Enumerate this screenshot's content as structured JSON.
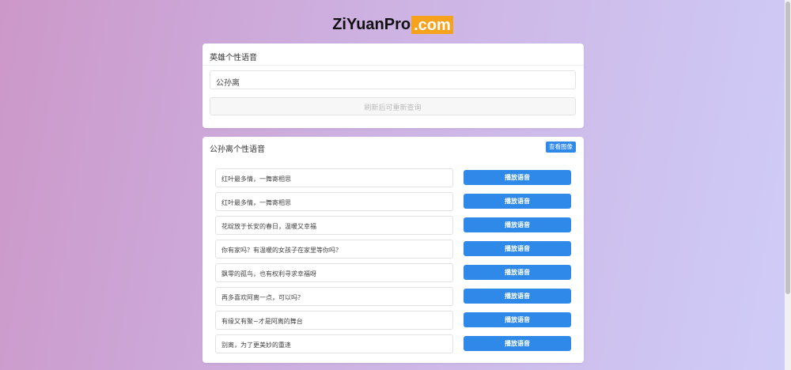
{
  "logo": {
    "main": "ZiYuanPro",
    "domain": ".com"
  },
  "search_card": {
    "header": "英雄个性语音",
    "hero_input_value": "公孙离",
    "refresh_label": "刷新后可重新查询"
  },
  "voice_card": {
    "title": "公孙离个性语音",
    "view_image_label": "查看图像",
    "items": [
      {
        "text": "红叶最多情，一舞寄相思",
        "button": "播放语音"
      },
      {
        "text": "红叶最多情，一舞寄相思",
        "button": "播放语音"
      },
      {
        "text": "花绽放于长安的春日，温暖又幸福",
        "button": "播放语音"
      },
      {
        "text": "你有家吗？有温暖的女孩子在家里等你吗？",
        "button": "播放语音"
      },
      {
        "text": "飘零的孤鸟，也有权利寻求幸福呀",
        "button": "播放语音"
      },
      {
        "text": "再多喜欢阿离一点，可以吗？",
        "button": "播放语音"
      },
      {
        "text": "有缘又有聚~才是阿离的舞台",
        "button": "播放语音"
      },
      {
        "text": "别离，为了更美妙的重逢",
        "button": "播放语音"
      }
    ]
  },
  "colors": {
    "accent": "#2f89e8",
    "logo_orange": "#f7a21c"
  }
}
